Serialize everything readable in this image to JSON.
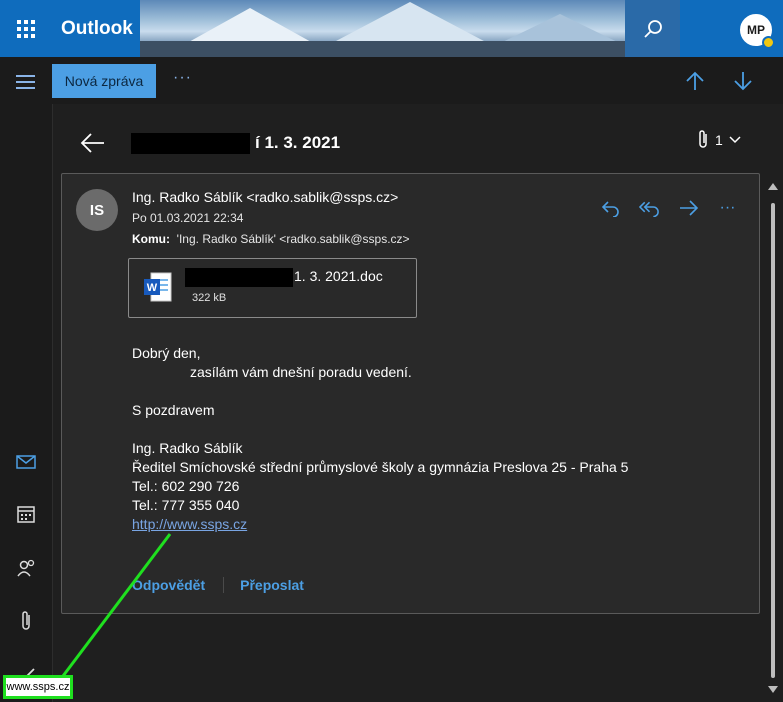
{
  "app": {
    "brand": "Outlook",
    "user_initials": "MP"
  },
  "command_bar": {
    "new_mail_label": "Nová zpráva",
    "more_label": "···"
  },
  "message": {
    "subject": "í 1. 3. 2021",
    "attachment_count": "1",
    "sender_initials": "IS",
    "sender": "Ing. Radko Sáblík <radko.sablik@ssps.cz>",
    "date": "Po 01.03.2021 22:34",
    "to_label": "Komu:",
    "to_value": "'Ing. Radko Sáblík' <radko.sablik@ssps.cz>",
    "more_actions_label": "···",
    "attachment": {
      "name": "1. 3. 2021.doc",
      "size": "322 kB"
    },
    "body": {
      "greeting": "Dobrý den,",
      "line1": "zasílám vám dnešní poradu vedení.",
      "closing": "S pozdravem",
      "sig_name": "Ing. Radko Sáblík",
      "sig_title": "Ředitel Smíchovské střední průmyslové školy a gymnázia Preslova 25 - Praha 5",
      "sig_tel1": "Tel.: 602 290 726",
      "sig_tel2": "Tel.: 777 355 040",
      "sig_link": "http://www.ssps.cz"
    },
    "reply_label": "Odpovědět",
    "forward_label": "Přeposlat"
  },
  "status_bar": {
    "url": "www.ssps.cz"
  },
  "colors": {
    "accent": "#0f6cbd",
    "link": "#79a5e3",
    "highlight": "#1fe01f"
  },
  "icons": [
    "waffle-icon",
    "search-icon",
    "hamburger-icon",
    "arrow-up-icon",
    "arrow-down-icon",
    "mail-icon",
    "calendar-icon",
    "people-icon",
    "attachment-icon",
    "todo-icon",
    "back-arrow-icon",
    "reply-icon",
    "reply-all-icon",
    "forward-icon",
    "word-doc-icon"
  ]
}
